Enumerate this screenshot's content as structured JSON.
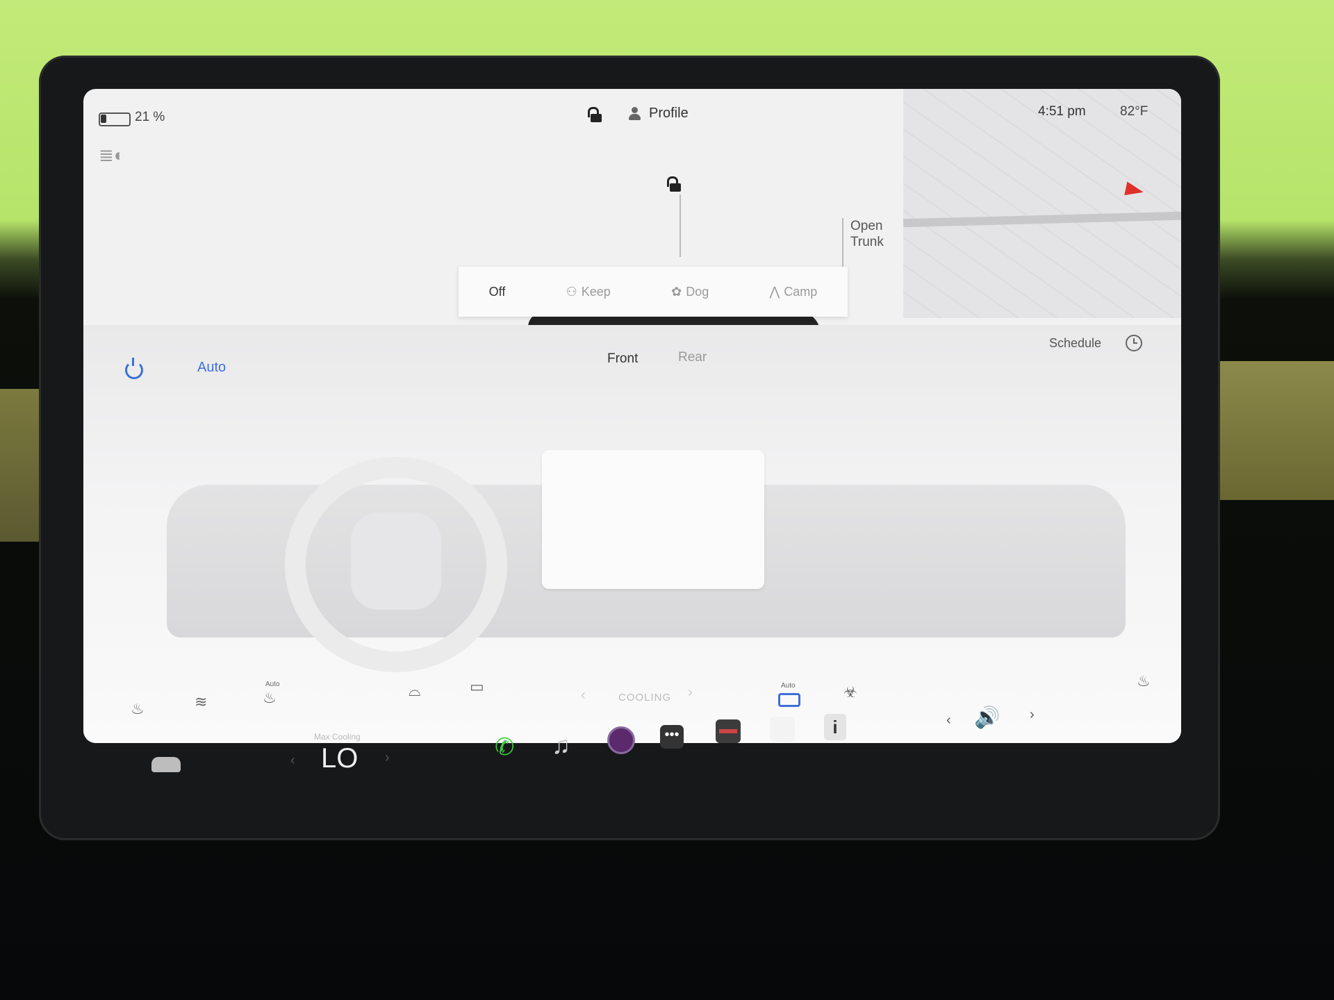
{
  "status": {
    "battery_percent": 21,
    "battery_text": "21 %",
    "profile_label": "Profile",
    "time": "4:51 pm",
    "outside_temp": "82°F"
  },
  "car_view": {
    "open_trunk_label": "Open\nTrunk"
  },
  "climate_keeper": {
    "modes": [
      "Off",
      "Keep",
      "Dog",
      "Camp"
    ],
    "selected": "Off"
  },
  "climate": {
    "auto_label": "Auto",
    "tabs": [
      "Front",
      "Rear"
    ],
    "active_tab": "Front",
    "schedule_label": "Schedule",
    "fan_status": "COOLING",
    "auto_small": "Auto",
    "accent_color": "#3e6fd8"
  },
  "dock": {
    "temp_caption": "Max Cooling",
    "temp_value": "LO"
  }
}
